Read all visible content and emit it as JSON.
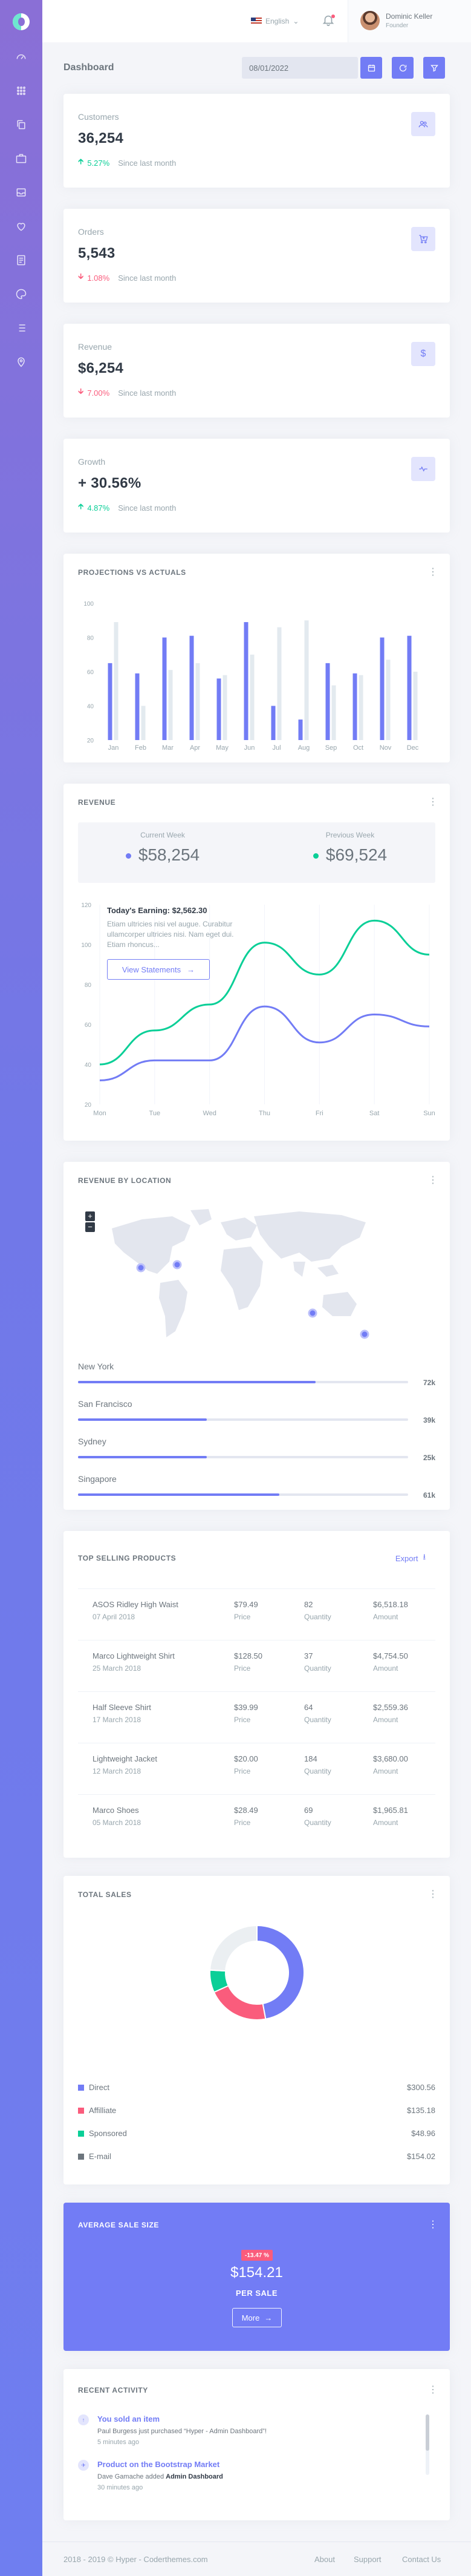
{
  "topbar": {
    "language": "English",
    "user_name": "Dominic Keller",
    "user_role": "Founder"
  },
  "header": {
    "title": "Dashboard",
    "date_value": "08/01/2022"
  },
  "stats": [
    {
      "label": "Customers",
      "value": "36,254",
      "change": "5.27%",
      "direction": "up",
      "since": "Since last month",
      "icon": "account-group-icon"
    },
    {
      "label": "Orders",
      "value": "5,543",
      "change": "1.08%",
      "direction": "down",
      "since": "Since last month",
      "icon": "cart-plus-icon"
    },
    {
      "label": "Revenue",
      "value": "$6,254",
      "change": "7.00%",
      "direction": "down",
      "since": "Since last month",
      "icon": "currency-usd-icon"
    },
    {
      "label": "Growth",
      "value": "+ 30.56%",
      "change": "4.87%",
      "direction": "up",
      "since": "Since last month",
      "icon": "pulse-icon"
    }
  ],
  "projections": {
    "title": "PROJECTIONS VS ACTUALS"
  },
  "revenue": {
    "title": "REVENUE",
    "current_week_label": "Current Week",
    "current_week_value": "$58,254",
    "previous_week_label": "Previous Week",
    "previous_week_value": "$69,524",
    "earning_title": "Today's Earning: $2,562.30",
    "earning_text": "Etiam ultricies nisi vel augue. Curabitur ullamcorper ultricies nisi. Nam eget dui. Etiam rhoncus...",
    "view_statements": "View Statements"
  },
  "locations": {
    "title": "REVENUE BY LOCATION",
    "items": [
      {
        "name": "New York",
        "value": "72k",
        "percent": 72
      },
      {
        "name": "San Francisco",
        "value": "39k",
        "percent": 39
      },
      {
        "name": "Sydney",
        "value": "25k",
        "percent": 39
      },
      {
        "name": "Singapore",
        "value": "61k",
        "percent": 61
      }
    ]
  },
  "products": {
    "title": "TOP SELLING PRODUCTS",
    "export": "Export",
    "price_label": "Price",
    "quantity_label": "Quantity",
    "amount_label": "Amount",
    "rows": [
      {
        "name": "ASOS Ridley High Waist",
        "date": "07 April 2018",
        "price": "$79.49",
        "quantity": "82",
        "amount": "$6,518.18"
      },
      {
        "name": "Marco Lightweight Shirt",
        "date": "25 March 2018",
        "price": "$128.50",
        "quantity": "37",
        "amount": "$4,754.50"
      },
      {
        "name": "Half Sleeve Shirt",
        "date": "17 March 2018",
        "price": "$39.99",
        "quantity": "64",
        "amount": "$2,559.36"
      },
      {
        "name": "Lightweight Jacket",
        "date": "12 March 2018",
        "price": "$20.00",
        "quantity": "184",
        "amount": "$3,680.00"
      },
      {
        "name": "Marco Shoes",
        "date": "05 March 2018",
        "price": "$28.49",
        "quantity": "69",
        "amount": "$1,965.81"
      }
    ]
  },
  "total_sales": {
    "title": "TOTAL SALES",
    "items": [
      {
        "name": "Direct",
        "value": "$300.56",
        "color": "#727cf5"
      },
      {
        "name": "Affilliate",
        "value": "$135.18",
        "color": "#fa5c7c"
      },
      {
        "name": "Sponsored",
        "value": "$48.96",
        "color": "#0acf97"
      },
      {
        "name": "E-mail",
        "value": "$154.02",
        "color": "#6c757d"
      }
    ]
  },
  "average_sale": {
    "title": "AVERAGE SALE SIZE",
    "badge": "-13.47 %",
    "value": "$154.21",
    "label": "PER SALE",
    "more": "More"
  },
  "activity": {
    "title": "RECENT ACTIVITY",
    "items": [
      {
        "title": "You sold an item",
        "desc_pre": "Paul Burgess just purchased “Hyper - Admin Dashboard”!",
        "desc_bold": "",
        "time": "5 minutes ago"
      },
      {
        "title": "Product on the Bootstrap Market",
        "desc_pre": "Dave Gamache added ",
        "desc_bold": "Admin Dashboard",
        "time": "30 minutes ago"
      }
    ]
  },
  "footer": {
    "copyright": "2018 - 2019 © Hyper - Coderthemes.com",
    "links": [
      "About",
      "Support",
      "Contact Us"
    ]
  },
  "chart_data": [
    {
      "type": "bar",
      "title": "PROJECTIONS VS ACTUALS",
      "categories": [
        "Jan",
        "Feb",
        "Mar",
        "Apr",
        "May",
        "Jun",
        "Jul",
        "Aug",
        "Sep",
        "Oct",
        "Nov",
        "Dec"
      ],
      "series": [
        {
          "values": [
            65,
            59,
            80,
            81,
            56,
            89,
            40,
            32,
            65,
            59,
            80,
            81
          ],
          "color": "#727cf5"
        },
        {
          "values": [
            89,
            40,
            61,
            65,
            58,
            70,
            86,
            90,
            52,
            58,
            67,
            60
          ],
          "color": "#e3eaef"
        }
      ],
      "ylim": [
        20,
        100
      ],
      "yticks": [
        20,
        40,
        60,
        80,
        100
      ],
      "grid": false
    },
    {
      "type": "line",
      "title": "REVENUE",
      "categories": [
        "Mon",
        "Tue",
        "Wed",
        "Thu",
        "Fri",
        "Sat",
        "Sun"
      ],
      "series": [
        {
          "values": [
            32,
            42,
            42,
            69,
            51,
            65,
            59
          ],
          "color": "#727cf5"
        },
        {
          "values": [
            40,
            57,
            70,
            101,
            85,
            112,
            95
          ],
          "color": "#0acf97"
        }
      ],
      "ylim": [
        20,
        120
      ],
      "yticks": [
        20,
        40,
        60,
        80,
        100,
        120
      ],
      "grid": true
    },
    {
      "type": "pie",
      "title": "TOTAL SALES",
      "categories": [
        "Direct",
        "Affilliate",
        "Sponsored",
        "E-mail"
      ],
      "values": [
        300.56,
        135.18,
        48.96,
        154.02
      ],
      "colors": [
        "#727cf5",
        "#fa5c7c",
        "#0acf97",
        "#ebeff2"
      ]
    }
  ]
}
